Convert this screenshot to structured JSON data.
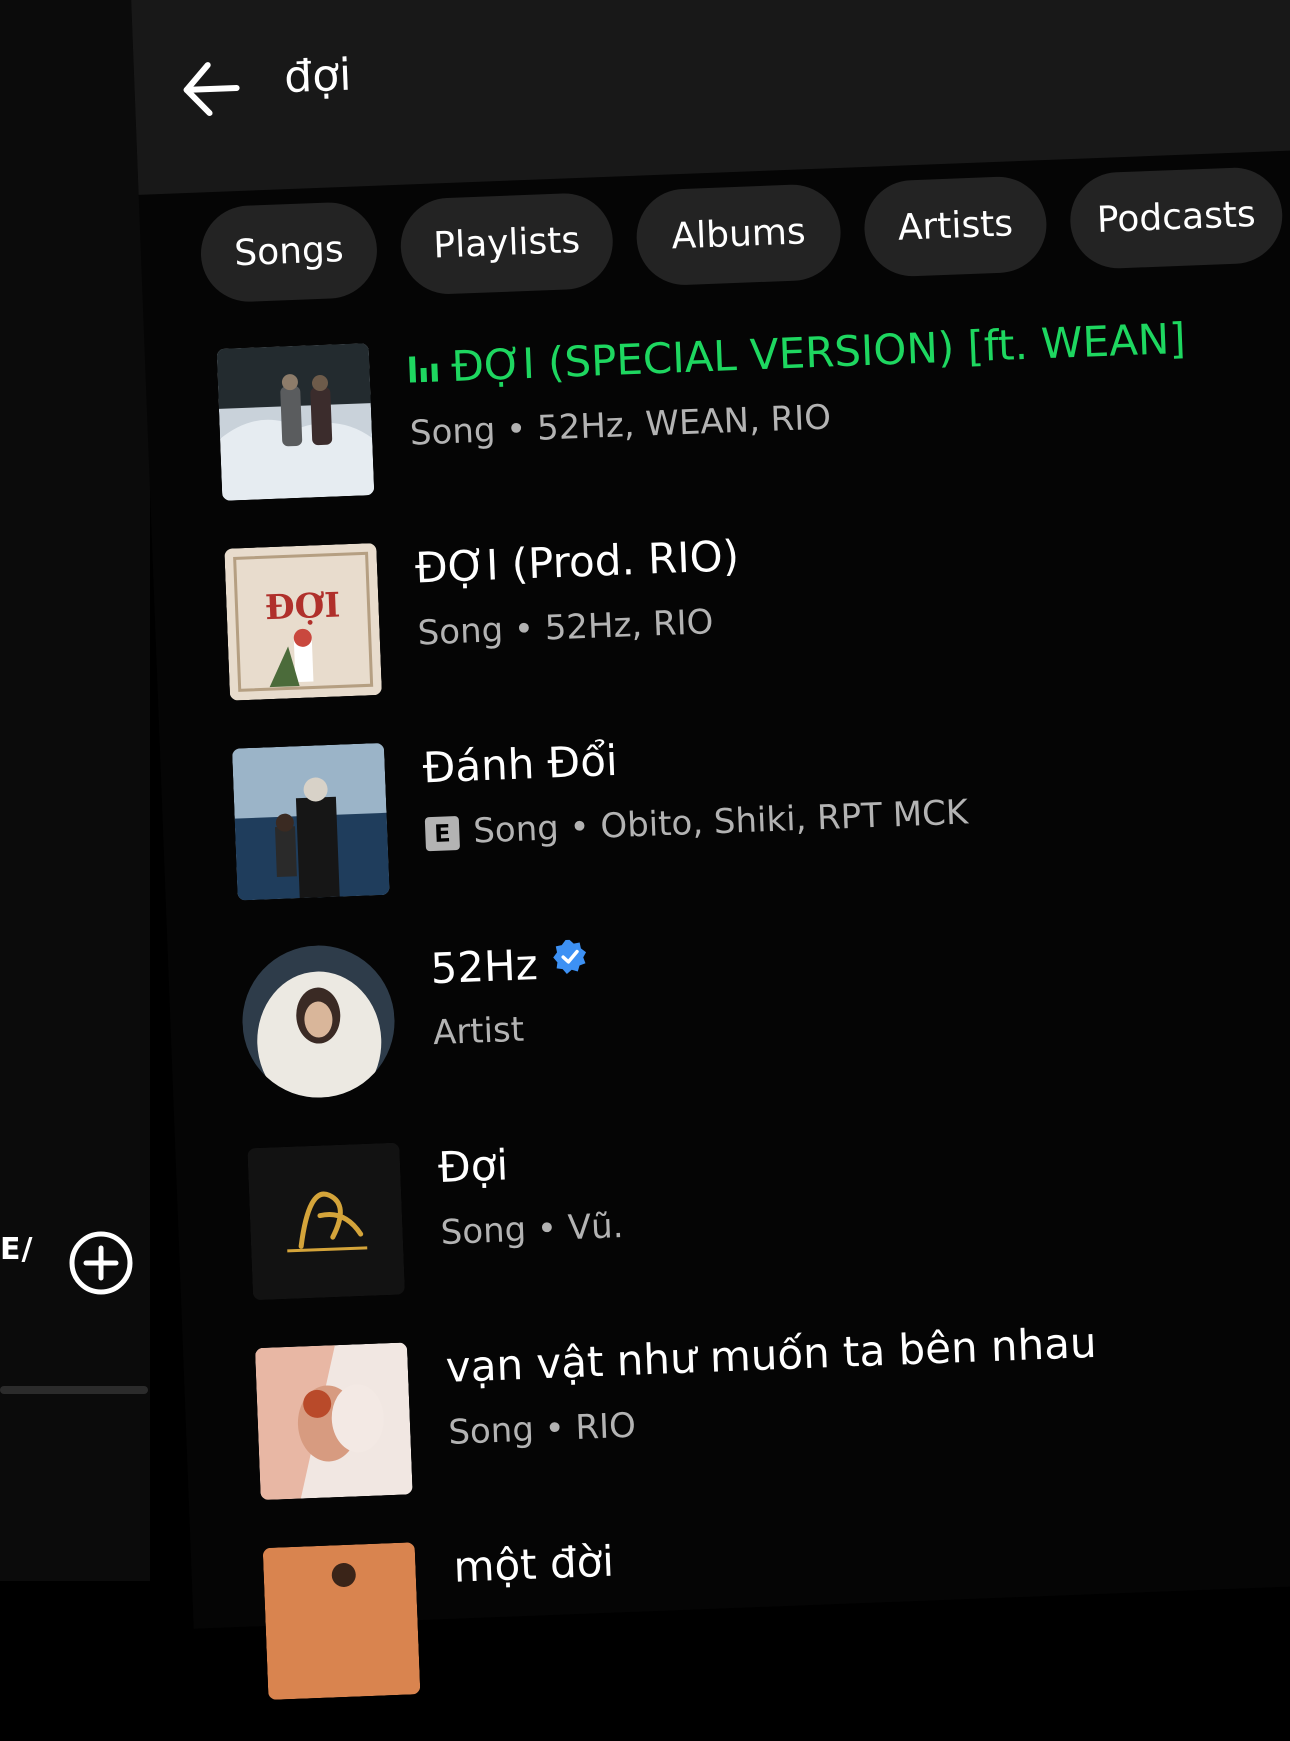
{
  "search": {
    "query": "đợi"
  },
  "left_pane": {
    "truncated_text": "E/"
  },
  "filters": [
    {
      "label": "Songs"
    },
    {
      "label": "Playlists"
    },
    {
      "label": "Albums"
    },
    {
      "label": "Artists"
    },
    {
      "label": "Podcasts"
    }
  ],
  "results": [
    {
      "title": "ĐỢI (SPECIAL VERSION) [ft. WEAN]",
      "type": "Song",
      "artists": "52Hz, WEAN, RIO",
      "playing": true,
      "explicit": false,
      "art_icon": "snowy-couple-cover"
    },
    {
      "title": "ĐỢI (Prod. RIO)",
      "type": "Song",
      "artists": "52Hz, RIO",
      "playing": false,
      "explicit": false,
      "art_icon": "doi-beige-cover",
      "art_text": "ĐỢI"
    },
    {
      "title": "Đánh Đổi",
      "type": "Song",
      "artists": "Obito, Shiki, RPT MCK",
      "playing": false,
      "explicit": true,
      "explicit_label": "E",
      "art_icon": "ocean-portrait-cover"
    },
    {
      "title": "52Hz",
      "type": "Artist",
      "verified": true,
      "art_icon": "artist-avatar"
    },
    {
      "title": "Đợi",
      "type": "Song",
      "artists": "Vũ.",
      "playing": false,
      "explicit": false,
      "art_icon": "gold-script-cover"
    },
    {
      "title": "vạn vật như muốn ta bên nhau",
      "type": "Song",
      "artists": "RIO",
      "playing": false,
      "explicit": false,
      "art_icon": "wedding-kiss-cover"
    },
    {
      "title": "một đời",
      "art_icon": "orange-cover"
    }
  ],
  "colors": {
    "active": "#1ed760",
    "verified": "#3d91f4",
    "subtext": "#b3b3b3",
    "chip": "#232323",
    "header": "#181818"
  }
}
